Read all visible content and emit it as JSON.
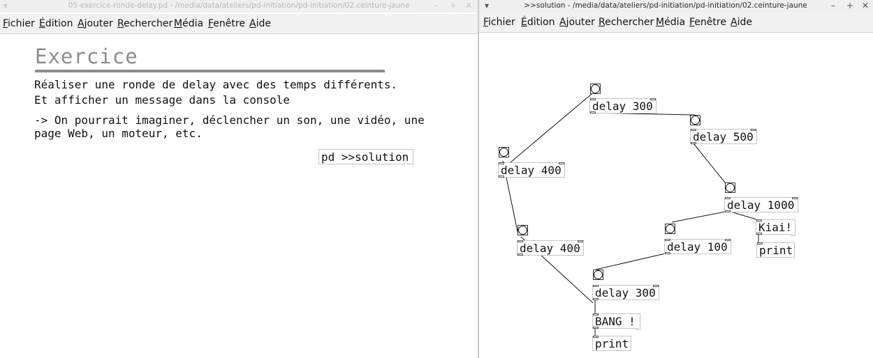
{
  "window_left": {
    "title": "05-exercice-ronde-delay.pd  - /media/data/ateliers/pd-initiation/pd-initiation/02.ceinture-jaune",
    "controls": {
      "minimize": "–",
      "maximize": "+",
      "close": "✕",
      "menu": "▾"
    },
    "menu": [
      "Fichier",
      "Édition",
      "Ajouter",
      "Rechercher",
      "Média",
      "Fenêtre",
      "Aide"
    ],
    "heading": "Exercice",
    "lines": [
      "Réaliser une ronde de delay avec des temps différents.",
      "Et afficher un message dans la console",
      "-> On pourrait imaginer, déclencher un son, une vidéo, une",
      "page Web, un moteur, etc."
    ],
    "subpatch": "pd >>solution"
  },
  "window_right": {
    "title": ">>solution  - /media/data/ateliers/pd-initiation/pd-initiation/02.ceinture-jaune",
    "controls": {
      "minimize": "–",
      "maximize": "+",
      "close": "✕",
      "menu": "▾"
    },
    "menu": [
      "Fichier",
      "Édition",
      "Ajouter",
      "Rechercher",
      "Média",
      "Fenêtre",
      "Aide"
    ],
    "objects": {
      "d1": "delay 300",
      "d2": "delay 500",
      "d3": "delay 1000",
      "d4": "delay 400",
      "d5": "delay 400",
      "d6": "delay 100",
      "d7": "delay 300",
      "print1": "print",
      "print2": "print"
    },
    "messages": {
      "m1": "Kiai!",
      "m2": "BANG !"
    }
  }
}
